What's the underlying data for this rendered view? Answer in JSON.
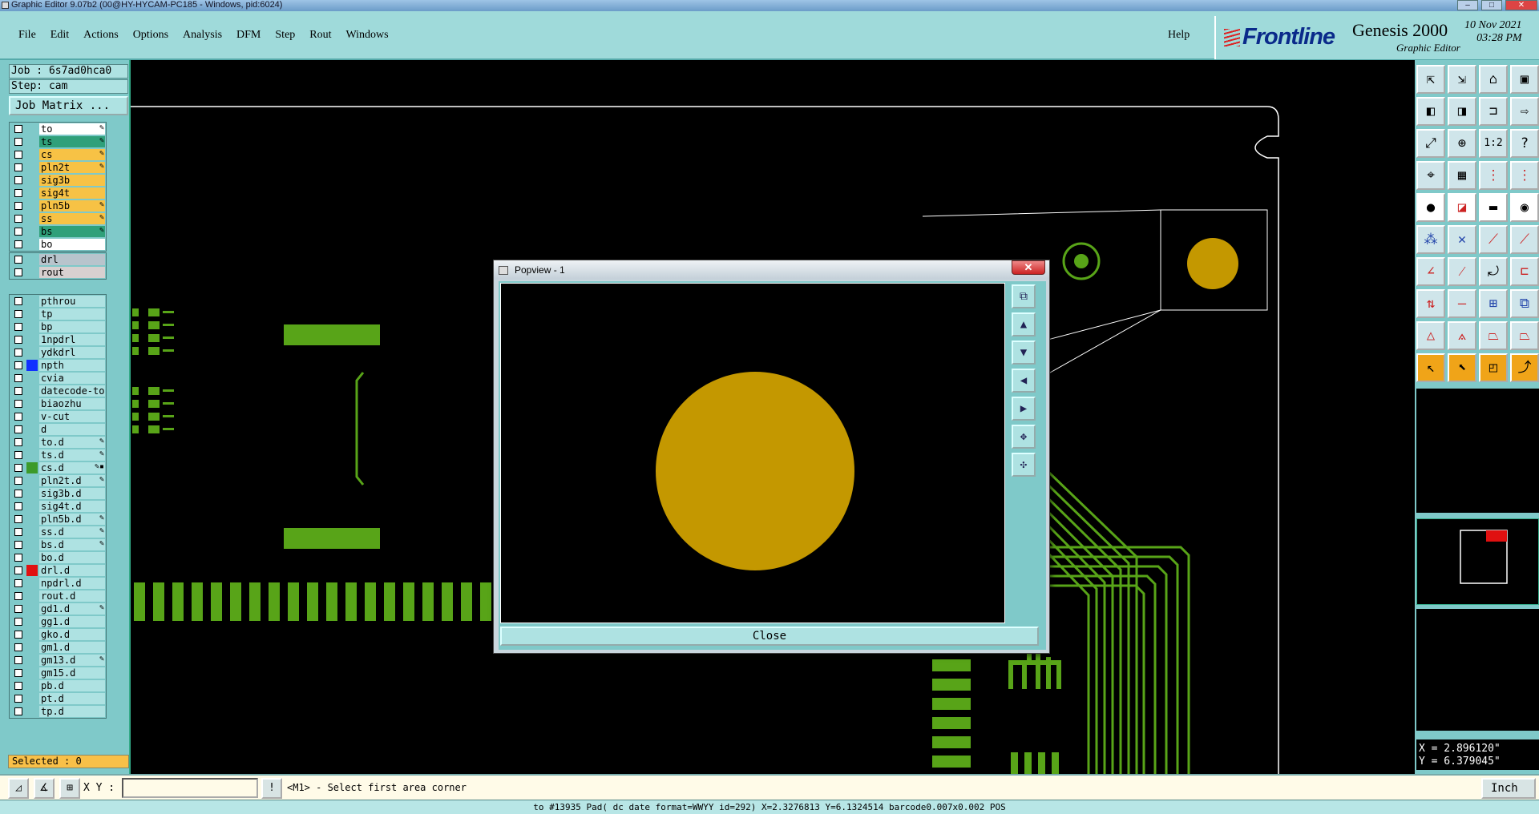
{
  "window": {
    "title": "Graphic Editor 9.07b2 (00@HY-HYCAM-PC185 - Windows, pid:6024)"
  },
  "menu": {
    "items": [
      {
        "label": "File"
      },
      {
        "label": "Edit"
      },
      {
        "label": "Actions"
      },
      {
        "label": "Options"
      },
      {
        "label": "Analysis"
      },
      {
        "label": "DFM"
      },
      {
        "label": "Step"
      },
      {
        "label": "Rout"
      },
      {
        "label": "Windows"
      }
    ],
    "help": "Help"
  },
  "brand": {
    "logo": "Frontline",
    "product": "Genesis 2000",
    "subtitle": "Graphic Editor",
    "date": "10 Nov 2021",
    "time": "03:28 PM"
  },
  "job": {
    "job_label": "Job : 6s7ad0hca0",
    "step_label": "Step: cam",
    "matrix_button": "Job Matrix ..."
  },
  "layers": {
    "board": [
      {
        "name": "to",
        "color": "#ffffff",
        "mark": "✎"
      },
      {
        "name": "ts",
        "color": "#2fa07a",
        "mark": "✎"
      },
      {
        "name": "cs",
        "color": "#f7c245",
        "mark": "✎"
      },
      {
        "name": "pln2t",
        "color": "#f7c245",
        "mark": "✎"
      },
      {
        "name": "sig3b",
        "color": "#f7c245",
        "mark": ""
      },
      {
        "name": "sig4t",
        "color": "#f7c245",
        "mark": ""
      },
      {
        "name": "pln5b",
        "color": "#f7c245",
        "mark": "✎"
      },
      {
        "name": "ss",
        "color": "#f7c245",
        "mark": "✎"
      },
      {
        "name": "bs",
        "color": "#2fa07a",
        "mark": "✎"
      },
      {
        "name": "bo",
        "color": "#ffffff",
        "mark": ""
      }
    ],
    "drill": [
      {
        "name": "drl",
        "color": "#b8c4cc",
        "mark": ""
      },
      {
        "name": "rout",
        "color": "#d8d0d0",
        "mark": ""
      }
    ],
    "misc": [
      {
        "name": "pthrou",
        "color": "#aee2e2",
        "mark": "",
        "swatch": ""
      },
      {
        "name": "tp",
        "color": "#aee2e2",
        "mark": "",
        "swatch": ""
      },
      {
        "name": "bp",
        "color": "#aee2e2",
        "mark": "",
        "swatch": ""
      },
      {
        "name": "1npdrl",
        "color": "#aee2e2",
        "mark": "",
        "swatch": ""
      },
      {
        "name": "ydkdrl",
        "color": "#aee2e2",
        "mark": "",
        "swatch": ""
      },
      {
        "name": "npth",
        "color": "#aee2e2",
        "mark": "",
        "swatch": "#1030ff"
      },
      {
        "name": "cvia",
        "color": "#aee2e2",
        "mark": "",
        "swatch": ""
      },
      {
        "name": "datecode-to",
        "color": "#aee2e2",
        "mark": "",
        "swatch": ""
      },
      {
        "name": "biaozhu",
        "color": "#aee2e2",
        "mark": "",
        "swatch": ""
      },
      {
        "name": "v-cut",
        "color": "#aee2e2",
        "mark": "",
        "swatch": ""
      },
      {
        "name": "d",
        "color": "#aee2e2",
        "mark": "",
        "swatch": ""
      },
      {
        "name": "to.d",
        "color": "#aee2e2",
        "mark": "✎",
        "swatch": ""
      },
      {
        "name": "ts.d",
        "color": "#aee2e2",
        "mark": "✎",
        "swatch": ""
      },
      {
        "name": "cs.d",
        "color": "#aee2e2",
        "mark": "✎▪",
        "swatch": "#3c9a2a"
      },
      {
        "name": "pln2t.d",
        "color": "#aee2e2",
        "mark": "✎",
        "swatch": ""
      },
      {
        "name": "sig3b.d",
        "color": "#aee2e2",
        "mark": "",
        "swatch": ""
      },
      {
        "name": "sig4t.d",
        "color": "#aee2e2",
        "mark": "",
        "swatch": ""
      },
      {
        "name": "pln5b.d",
        "color": "#aee2e2",
        "mark": "✎",
        "swatch": ""
      },
      {
        "name": "ss.d",
        "color": "#aee2e2",
        "mark": "✎",
        "swatch": ""
      },
      {
        "name": "bs.d",
        "color": "#aee2e2",
        "mark": "✎",
        "swatch": ""
      },
      {
        "name": "bo.d",
        "color": "#aee2e2",
        "mark": "",
        "swatch": ""
      },
      {
        "name": "drl.d",
        "color": "#aee2e2",
        "mark": "",
        "swatch": "#e01010"
      },
      {
        "name": "npdrl.d",
        "color": "#aee2e2",
        "mark": "",
        "swatch": ""
      },
      {
        "name": "rout.d",
        "color": "#aee2e2",
        "mark": "",
        "swatch": ""
      },
      {
        "name": "gd1.d",
        "color": "#aee2e2",
        "mark": "✎",
        "swatch": ""
      },
      {
        "name": "gg1.d",
        "color": "#aee2e2",
        "mark": "",
        "swatch": ""
      },
      {
        "name": "gko.d",
        "color": "#aee2e2",
        "mark": "",
        "swatch": ""
      },
      {
        "name": "gm1.d",
        "color": "#aee2e2",
        "mark": "",
        "swatch": ""
      },
      {
        "name": "gm13.d",
        "color": "#aee2e2",
        "mark": "✎",
        "swatch": ""
      },
      {
        "name": "gm15.d",
        "color": "#aee2e2",
        "mark": "",
        "swatch": ""
      },
      {
        "name": "pb.d",
        "color": "#aee2e2",
        "mark": "",
        "swatch": ""
      },
      {
        "name": "pt.d",
        "color": "#aee2e2",
        "mark": "",
        "swatch": ""
      },
      {
        "name": "tp.d",
        "color": "#aee2e2",
        "mark": "",
        "swatch": ""
      }
    ]
  },
  "selected": "Selected : 0",
  "popview": {
    "title": "Popview - 1",
    "close_label": "Close",
    "close_x": "✕"
  },
  "coords": {
    "x": "X = 2.896120\"",
    "y": "Y = 6.379045\""
  },
  "command": {
    "xy_label": "X Y :",
    "xy_value": "",
    "prompt": "<M1> - Select first area corner",
    "units": "Inch"
  },
  "status": "to #13935 Pad( dc  date format=WWYY id=292) X=2.3276813 Y=6.1324514 barcode0.007x0.002 POS",
  "colors": {
    "copper": "#58a418",
    "pad": "#c49800",
    "outline": "#ffffff",
    "hole": "#3aacf0",
    "accent": "#f0a418"
  }
}
